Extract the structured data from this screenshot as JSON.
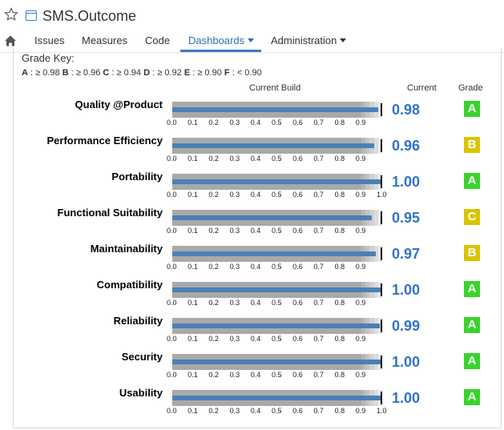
{
  "header": {
    "title": "SMS.Outcome"
  },
  "nav": {
    "items": [
      {
        "label": "Issues"
      },
      {
        "label": "Measures"
      },
      {
        "label": "Code"
      },
      {
        "label": "Dashboards",
        "active": true
      },
      {
        "label": "Administration"
      }
    ]
  },
  "grade_key": {
    "title": "Grade Key:",
    "entries": [
      {
        "grade": "A",
        "rule": ": ≥ 0.98"
      },
      {
        "grade": "B",
        "rule": ": ≥ 0.96"
      },
      {
        "grade": "C",
        "rule": ": ≥ 0.94"
      },
      {
        "grade": "D",
        "rule": ": ≥ 0.92"
      },
      {
        "grade": "E",
        "rule": ": ≥ 0.90"
      },
      {
        "grade": "F",
        "rule": ": < 0.90"
      }
    ]
  },
  "columns": {
    "current_build": "Current Build",
    "current": "Current",
    "grade": "Grade"
  },
  "colors": {
    "grade_A": "#39d42b",
    "grade_B": "#d7c600",
    "grade_C": "#d7c600",
    "value_text": "#2f73c9",
    "bar": "#4a80b6"
  },
  "chart_data": {
    "type": "bullet",
    "title": "",
    "axis_ticks_normal": [
      "0.0",
      "0.1",
      "0.2",
      "0.3",
      "0.4",
      "0.5",
      "0.6",
      "0.7",
      "0.8",
      "0.9"
    ],
    "axis_ticks_full": [
      "0.0",
      "0.1",
      "0.2",
      "0.3",
      "0.4",
      "0.5",
      "0.6",
      "0.7",
      "0.8",
      "0.9",
      "1.0"
    ],
    "bands": [
      0.9,
      0.92,
      0.94,
      0.96,
      0.98,
      1.0
    ],
    "rows": [
      {
        "name": "Quality @Product",
        "value": 0.98,
        "display": "0.98",
        "grade": "A",
        "show_one": false
      },
      {
        "name": "Performance Efficiency",
        "value": 0.96,
        "display": "0.96",
        "grade": "B",
        "show_one": false
      },
      {
        "name": "Portability",
        "value": 1.0,
        "display": "1.00",
        "grade": "A",
        "show_one": true
      },
      {
        "name": "Functional Suitability",
        "value": 0.95,
        "display": "0.95",
        "grade": "C",
        "show_one": false
      },
      {
        "name": "Maintainability",
        "value": 0.97,
        "display": "0.97",
        "grade": "B",
        "show_one": false
      },
      {
        "name": "Compatibility",
        "value": 1.0,
        "display": "1.00",
        "grade": "A",
        "show_one": false
      },
      {
        "name": "Reliability",
        "value": 0.99,
        "display": "0.99",
        "grade": "A",
        "show_one": false
      },
      {
        "name": "Security",
        "value": 1.0,
        "display": "1.00",
        "grade": "A",
        "show_one": false
      },
      {
        "name": "Usability",
        "value": 1.0,
        "display": "1.00",
        "grade": "A",
        "show_one": true
      }
    ]
  }
}
